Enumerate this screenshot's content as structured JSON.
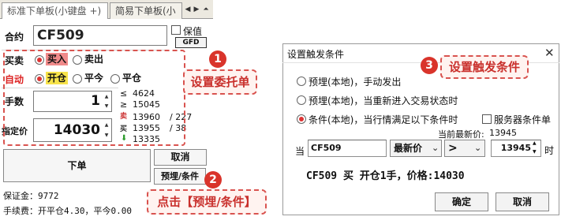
{
  "order_panel": {
    "tabs": {
      "standard": "标准下单板(小键盘 +)",
      "simple": "简易下单板(小"
    },
    "contract": {
      "label": "合约",
      "value": "CF509",
      "hold_label": "保值",
      "gfd": "GFD"
    },
    "direction": {
      "label": "买卖",
      "buy": "买入",
      "sell": "卖出"
    },
    "auto": {
      "label": "自动",
      "open": "开仓",
      "close_today": "平今",
      "close": "平仓"
    },
    "quantity": {
      "label": "手数",
      "value": "1"
    },
    "price": {
      "label": "指定价",
      "value": "14030"
    },
    "market": {
      "limit_up_sym": "≤",
      "limit_up": "4624",
      "limit_down_sym": "≥",
      "limit_down": "15045",
      "sell_glyph": "卖",
      "sell_price": "13960",
      "sell_vol": "/ 227",
      "buy_glyph": "买",
      "buy_price": "13955",
      "buy_vol": "/ 38",
      "last_price": "13335"
    },
    "buttons": {
      "place": "下单",
      "cancel": "取消",
      "preset": "预埋/条件"
    },
    "margin": "保证金：9772",
    "fee": "手续费：开平仓4.30，平今0.00"
  },
  "callouts": {
    "c1": {
      "num": "1",
      "text": "设置委托单"
    },
    "c2": {
      "num": "2",
      "text": "点击【预埋/条件】"
    },
    "c3": {
      "num": "3",
      "text": "设置触发条件"
    }
  },
  "dialog": {
    "title": "设置触发条件",
    "close": "✕",
    "opt1": "预埋(本地)，手动发出",
    "opt2": "预埋(本地)，当重新进入交易状态时",
    "opt3": "条件(本地)，当行情满足以下条件时",
    "server_cond": "服务器条件单",
    "last_price_label": "当前最新价:",
    "last_price_value": "13945",
    "when": "当",
    "contract": "CF509",
    "field": "最新价",
    "operator": ">",
    "threshold": "13945",
    "time_suffix": "时",
    "summary": "CF509 买 开仓1手，价格:14030",
    "ok": "确定",
    "cancel": "取消"
  }
}
